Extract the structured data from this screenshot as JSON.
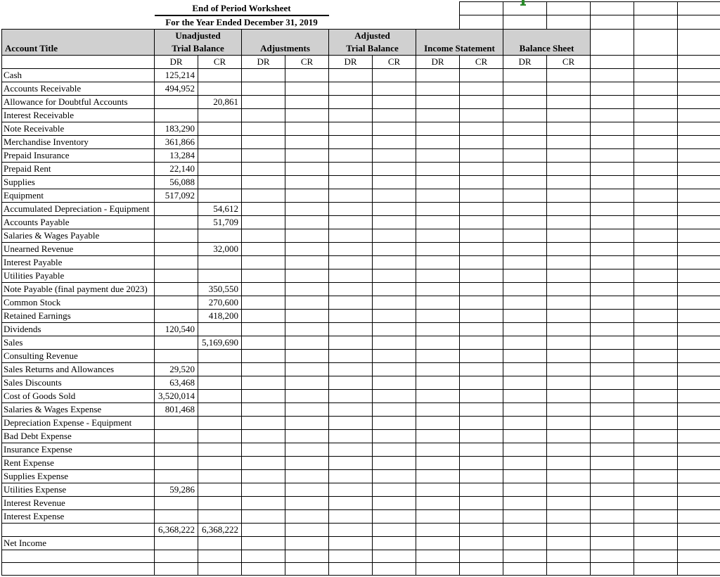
{
  "title": "End of Period Worksheet",
  "subtitle": "For the Year Ended December 31, 2019",
  "headers": {
    "account_title": "Account Title",
    "unadjusted": "Unadjusted",
    "trial_balance": "Trial Balance",
    "adjustments": "Adjustments",
    "adjusted": "Adjusted",
    "income_statement": "Income Statement",
    "balance_sheet": "Balance Sheet",
    "dr": "DR",
    "cr": "CR"
  },
  "rows": [
    {
      "title": "Cash",
      "utb_dr": "125,214",
      "utb_cr": ""
    },
    {
      "title": "Accounts Receivable",
      "utb_dr": "494,952",
      "utb_cr": ""
    },
    {
      "title": "Allowance for Doubtful Accounts",
      "utb_dr": "",
      "utb_cr": "20,861"
    },
    {
      "title": "Interest Receivable",
      "utb_dr": "",
      "utb_cr": ""
    },
    {
      "title": "Note Receivable",
      "utb_dr": "183,290",
      "utb_cr": ""
    },
    {
      "title": "Merchandise Inventory",
      "utb_dr": "361,866",
      "utb_cr": ""
    },
    {
      "title": "Prepaid Insurance",
      "utb_dr": "13,284",
      "utb_cr": ""
    },
    {
      "title": "Prepaid Rent",
      "utb_dr": "22,140",
      "utb_cr": ""
    },
    {
      "title": "Supplies",
      "utb_dr": "56,088",
      "utb_cr": ""
    },
    {
      "title": "Equipment",
      "utb_dr": "517,092",
      "utb_cr": ""
    },
    {
      "title": "Accumulated Depreciation -  Equipment",
      "utb_dr": "",
      "utb_cr": "54,612"
    },
    {
      "title": "Accounts Payable",
      "utb_dr": "",
      "utb_cr": "51,709"
    },
    {
      "title": "Salaries & Wages Payable",
      "utb_dr": "",
      "utb_cr": ""
    },
    {
      "title": "Unearned Revenue",
      "utb_dr": "",
      "utb_cr": "32,000"
    },
    {
      "title": "Interest Payable",
      "utb_dr": "",
      "utb_cr": ""
    },
    {
      "title": "Utilities Payable",
      "utb_dr": "",
      "utb_cr": ""
    },
    {
      "title": "Note Payable (final payment due 2023)",
      "utb_dr": "",
      "utb_cr": "350,550"
    },
    {
      "title": "Common Stock",
      "utb_dr": "",
      "utb_cr": "270,600"
    },
    {
      "title": "Retained Earnings",
      "utb_dr": "",
      "utb_cr": "418,200"
    },
    {
      "title": "Dividends",
      "utb_dr": "120,540",
      "utb_cr": ""
    },
    {
      "title": "Sales",
      "utb_dr": "",
      "utb_cr": "5,169,690"
    },
    {
      "title": "Consulting Revenue",
      "utb_dr": "",
      "utb_cr": ""
    },
    {
      "title": "Sales Returns and Allowances",
      "utb_dr": "29,520",
      "utb_cr": ""
    },
    {
      "title": "Sales Discounts",
      "utb_dr": "63,468",
      "utb_cr": ""
    },
    {
      "title": "Cost of Goods Sold",
      "utb_dr": "3,520,014",
      "utb_cr": ""
    },
    {
      "title": "Salaries & Wages Expense",
      "utb_dr": "801,468",
      "utb_cr": ""
    },
    {
      "title": "Depreciation Expense - Equipment",
      "utb_dr": "",
      "utb_cr": ""
    },
    {
      "title": "Bad Debt Expense",
      "utb_dr": "",
      "utb_cr": ""
    },
    {
      "title": "Insurance Expense",
      "utb_dr": "",
      "utb_cr": ""
    },
    {
      "title": "Rent Expense",
      "utb_dr": "",
      "utb_cr": ""
    },
    {
      "title": "Supplies Expense",
      "utb_dr": "",
      "utb_cr": ""
    },
    {
      "title": "Utilities Expense",
      "utb_dr": "59,286",
      "utb_cr": ""
    },
    {
      "title": "Interest Revenue",
      "utb_dr": "",
      "utb_cr": ""
    },
    {
      "title": "Interest Expense",
      "utb_dr": "",
      "utb_cr": ""
    }
  ],
  "totals": {
    "utb_dr": "6,368,222",
    "utb_cr": "6,368,222"
  },
  "net_income_label": "Net Income"
}
